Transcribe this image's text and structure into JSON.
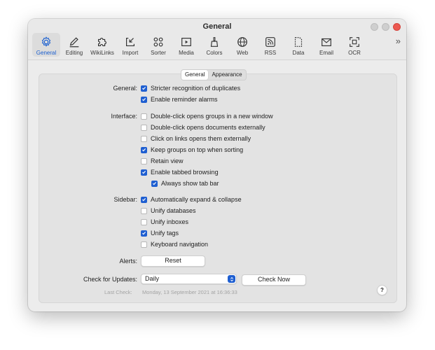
{
  "window": {
    "title": "General"
  },
  "toolbar": {
    "items": [
      {
        "label": "General",
        "icon": "gear-icon",
        "active": true
      },
      {
        "label": "Editing",
        "icon": "pencil-icon"
      },
      {
        "label": "WikiLinks",
        "icon": "puzzle-icon"
      },
      {
        "label": "Import",
        "icon": "import-icon"
      },
      {
        "label": "Sorter",
        "icon": "sorter-icon"
      },
      {
        "label": "Media",
        "icon": "media-icon"
      },
      {
        "label": "Colors",
        "icon": "brush-icon"
      },
      {
        "label": "Web",
        "icon": "globe-icon"
      },
      {
        "label": "RSS",
        "icon": "rss-icon"
      },
      {
        "label": "Data",
        "icon": "data-icon"
      },
      {
        "label": "Email",
        "icon": "envelope-icon"
      },
      {
        "label": "OCR",
        "icon": "ocr-icon"
      }
    ],
    "overflow": "»"
  },
  "tabs": {
    "general": "General",
    "appearance": "Appearance",
    "selected": "General"
  },
  "general_section": {
    "label": "General:",
    "stricter": {
      "label": "Stricter recognition of duplicates",
      "checked": true
    },
    "reminders": {
      "label": "Enable reminder alarms",
      "checked": true
    }
  },
  "interface_section": {
    "label": "Interface:",
    "dbl_groups": {
      "label": "Double-click opens groups in a new window",
      "checked": false
    },
    "dbl_docs": {
      "label": "Double-click opens documents externally",
      "checked": false
    },
    "click_links": {
      "label": "Click on links opens them externally",
      "checked": false
    },
    "keep_groups": {
      "label": "Keep groups on top when sorting",
      "checked": true
    },
    "retain_view": {
      "label": "Retain view",
      "checked": false
    },
    "tabbed": {
      "label": "Enable tabbed browsing",
      "checked": true
    },
    "tab_bar": {
      "label": "Always show tab bar",
      "checked": true
    }
  },
  "sidebar_section": {
    "label": "Sidebar:",
    "auto_expand": {
      "label": "Automatically expand & collapse",
      "checked": true
    },
    "unify_db": {
      "label": "Unify databases",
      "checked": false
    },
    "unify_inboxes": {
      "label": "Unify inboxes",
      "checked": false
    },
    "unify_tags": {
      "label": "Unify tags",
      "checked": true
    },
    "keyboard_nav": {
      "label": "Keyboard navigation",
      "checked": false
    }
  },
  "alerts": {
    "label": "Alerts:",
    "reset_label": "Reset"
  },
  "updates": {
    "label": "Check for Updates:",
    "frequency": "Daily",
    "check_now_label": "Check Now",
    "last_check_label": "Last Check:",
    "last_check_value": "Monday, 13 September 2021 at 16:36:33"
  },
  "help": {
    "label": "?"
  },
  "colors": {
    "accent": "#1f5fd1",
    "close": "#ec5a52"
  }
}
